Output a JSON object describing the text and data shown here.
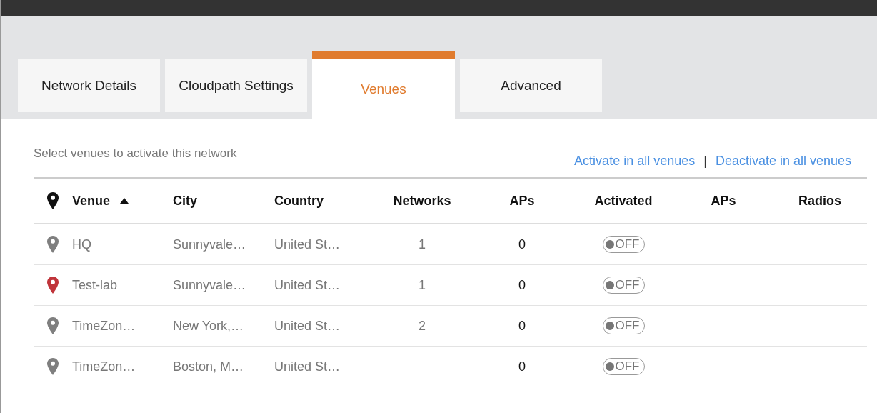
{
  "tabs": [
    {
      "label": "Network Details",
      "selected": false
    },
    {
      "label": "Cloudpath Settings",
      "selected": false
    },
    {
      "label": "Venues",
      "selected": true
    },
    {
      "label": "Advanced",
      "selected": false
    }
  ],
  "instruction": "Select venues to activate this network",
  "actions": {
    "activate": "Activate in all venues",
    "separator": "|",
    "deactivate": "Deactivate in all venues"
  },
  "table": {
    "columns": [
      {
        "label": "Venue",
        "sorted_ascending": true
      },
      {
        "label": "City"
      },
      {
        "label": "Country"
      },
      {
        "label": "Networks"
      },
      {
        "label": "APs"
      },
      {
        "label": "Activated"
      },
      {
        "label": "APs"
      },
      {
        "label": "Radios"
      }
    ],
    "rows": [
      {
        "venue": "HQ",
        "color": "#7f7f7f",
        "city": "Sunnyvale…",
        "country": "United St…",
        "networks": "1",
        "aps": "0",
        "toggle": {
          "label": "OFF",
          "on": false
        }
      },
      {
        "venue": "Test-lab",
        "color": "#c0343a",
        "city": "Sunnyvale…",
        "country": "United St…",
        "networks": "1",
        "aps": "0",
        "toggle": {
          "label": "OFF",
          "on": false
        }
      },
      {
        "venue": "TimeZon…",
        "color": "#7f7f7f",
        "city": "New York,…",
        "country": "United St…",
        "networks": "2",
        "aps": "0",
        "toggle": {
          "label": "OFF",
          "on": false
        }
      },
      {
        "venue": "TimeZon…",
        "color": "#7f7f7f",
        "city": "Boston, M…",
        "country": "United St…",
        "aps": "0",
        "toggle": {
          "label": "OFF",
          "on": false
        }
      }
    ]
  }
}
